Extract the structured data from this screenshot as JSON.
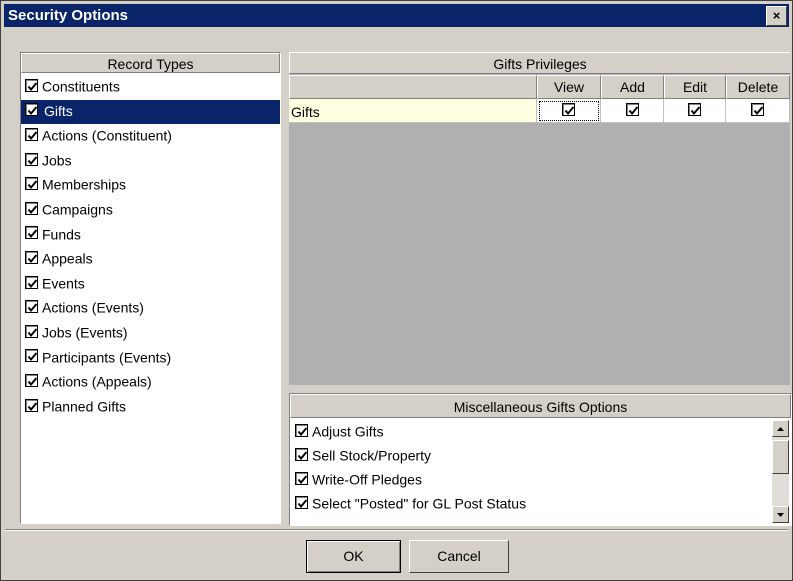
{
  "window": {
    "title": "Security Options",
    "close_label": "×"
  },
  "record_types": {
    "header": "Record Types",
    "selected_index": 1,
    "items": [
      {
        "label": "Constituents",
        "checked": true
      },
      {
        "label": "Gifts",
        "checked": true
      },
      {
        "label": "Actions (Constituent)",
        "checked": true
      },
      {
        "label": "Jobs",
        "checked": true
      },
      {
        "label": "Memberships",
        "checked": true
      },
      {
        "label": "Campaigns",
        "checked": true
      },
      {
        "label": "Funds",
        "checked": true
      },
      {
        "label": "Appeals",
        "checked": true
      },
      {
        "label": "Events",
        "checked": true
      },
      {
        "label": "Actions (Events)",
        "checked": true
      },
      {
        "label": "Jobs (Events)",
        "checked": true
      },
      {
        "label": "Participants (Events)",
        "checked": true
      },
      {
        "label": "Actions (Appeals)",
        "checked": true
      },
      {
        "label": "Planned Gifts",
        "checked": true
      }
    ]
  },
  "privileges": {
    "header": "Gifts Privileges",
    "columns": [
      "View",
      "Add",
      "Edit",
      "Delete"
    ],
    "rows": [
      {
        "label": "Gifts",
        "values": [
          true,
          true,
          true,
          true
        ]
      }
    ]
  },
  "misc_options": {
    "header": "Miscellaneous Gifts Options",
    "items": [
      {
        "label": "Adjust Gifts",
        "checked": true
      },
      {
        "label": "Sell Stock/Property",
        "checked": true
      },
      {
        "label": "Write-Off Pledges",
        "checked": true
      },
      {
        "label": "Select \"Posted\" for GL Post Status",
        "checked": true
      }
    ]
  },
  "buttons": {
    "ok_label": "OK",
    "cancel_label": "Cancel"
  }
}
